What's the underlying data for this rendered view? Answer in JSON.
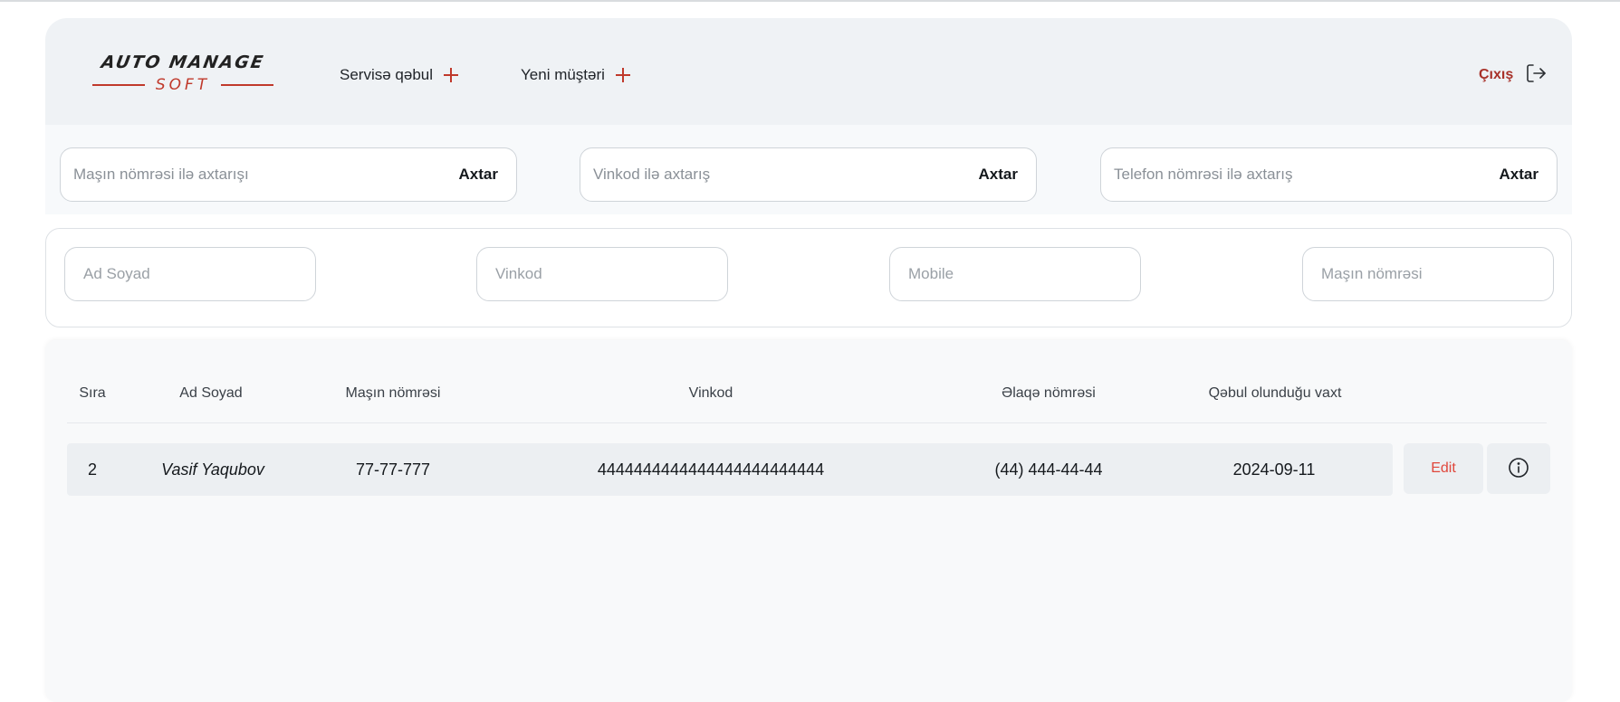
{
  "brand": {
    "top": "AUTO MANAGE",
    "bottom": "SOFT"
  },
  "nav": [
    {
      "label": "Servisə qəbul"
    },
    {
      "label": "Yeni müştəri"
    }
  ],
  "logout": {
    "label": "Çıxış"
  },
  "search": [
    {
      "placeholder": "Maşın nömrəsi ilə axtarışı",
      "button": "Axtar"
    },
    {
      "placeholder": "Vinkod ilə axtarış",
      "button": "Axtar"
    },
    {
      "placeholder": "Telefon nömrəsi ilə axtarış",
      "button": "Axtar"
    }
  ],
  "filters": [
    {
      "placeholder": "Ad Soyad"
    },
    {
      "placeholder": "Vinkod"
    },
    {
      "placeholder": "Mobile"
    },
    {
      "placeholder": "Maşın nömrəsi"
    }
  ],
  "table": {
    "headers": [
      "Sıra",
      "Ad Soyad",
      "Maşın nömrəsi",
      "Vinkod",
      "Əlaqə nömrəsi",
      "Qəbul olunduğu vaxt"
    ],
    "rows": [
      {
        "index": "2",
        "name": "Vasif Yaqubov",
        "plate": "77-77-777",
        "vin": "4444444444444444444444444",
        "phone": "(44) 444-44-44",
        "date": "2024-09-11",
        "edit_label": "Edit",
        "info_icon": "info-icon"
      }
    ]
  },
  "colors": {
    "accent": "#c0392b",
    "logout": "#a8322a",
    "edit": "#e0473c",
    "header_bg": "#eff2f5"
  }
}
